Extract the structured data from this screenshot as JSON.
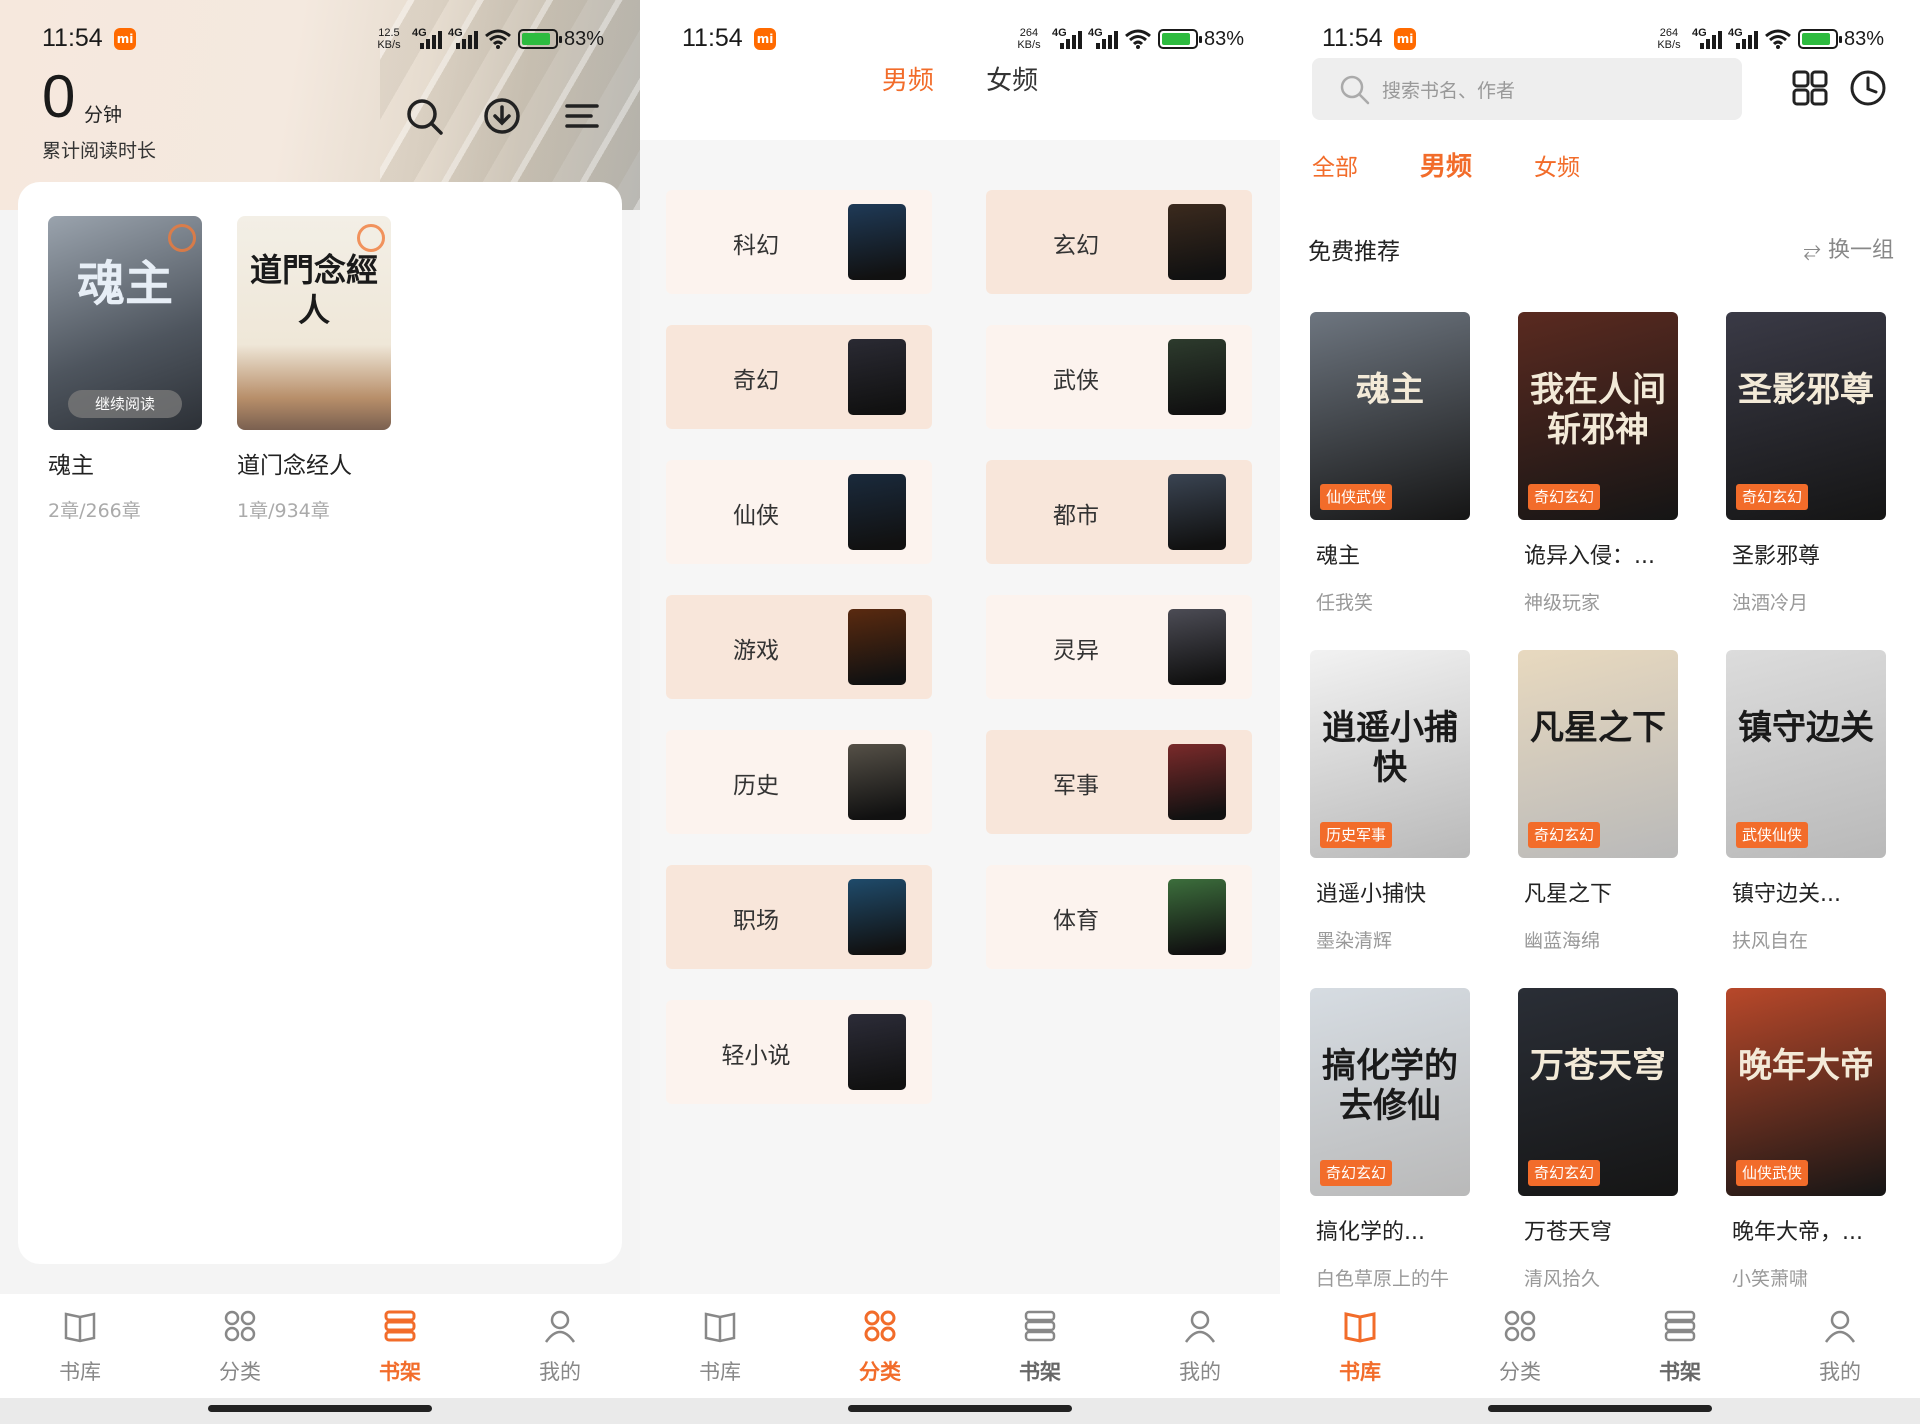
{
  "status": {
    "time": "11:54",
    "mi": "mi",
    "net1": "12.5",
    "net2": "264",
    "unit": "KB/s",
    "g": "4G",
    "battery": "83%"
  },
  "shelf": {
    "read_value": "0",
    "read_unit": "分钟",
    "read_label": "累计阅读时长",
    "continue_label": "继续阅读",
    "books": [
      {
        "title": "魂主",
        "progress": "2章/266章",
        "cover_text": "魂主"
      },
      {
        "title": "道门念经人",
        "progress": "1章/934章",
        "cover_text": "道門念經人"
      }
    ]
  },
  "category": {
    "tabs": [
      "男频",
      "女频"
    ],
    "items": [
      {
        "label": "科幻",
        "color": "#1f3a57"
      },
      {
        "label": "玄幻",
        "color": "#3b2a1e"
      },
      {
        "label": "奇幻",
        "color": "#2a2a33"
      },
      {
        "label": "武侠",
        "color": "#2d3b2d"
      },
      {
        "label": "仙侠",
        "color": "#1a2a3c"
      },
      {
        "label": "都市",
        "color": "#3a4452"
      },
      {
        "label": "游戏",
        "color": "#5a2a10"
      },
      {
        "label": "灵异",
        "color": "#4c4c55"
      },
      {
        "label": "历史",
        "color": "#555047"
      },
      {
        "label": "军事",
        "color": "#7a2a2a"
      },
      {
        "label": "职场",
        "color": "#1f4b6b"
      },
      {
        "label": "体育",
        "color": "#3c6e3c"
      },
      {
        "label": "轻小说",
        "color": "#2c2c38"
      }
    ]
  },
  "library": {
    "search_placeholder": "搜索书名、作者",
    "tabs": [
      "全部",
      "男频",
      "女频"
    ],
    "rec_title": "免费推荐",
    "rec_change": "换一组",
    "books": [
      {
        "title": "魂主",
        "author": "任我笑",
        "tag": "仙侠武侠",
        "cover_text": "魂主",
        "color": "#6e7680"
      },
      {
        "title": "诡异入侵：...",
        "author": "神级玩家",
        "tag": "奇幻玄幻",
        "cover_text": "我在人间斩邪神",
        "color": "#5a2a20"
      },
      {
        "title": "圣影邪尊",
        "author": "浊酒冷月",
        "tag": "奇幻玄幻",
        "cover_text": "圣影邪尊",
        "color": "#3a3a46"
      },
      {
        "title": "逍遥小捕快",
        "author": "墨染清辉",
        "tag": "历史军事",
        "cover_text": "逍遥小捕快",
        "color": "#f2f2f2"
      },
      {
        "title": "凡星之下",
        "author": "幽蓝海绵",
        "tag": "奇幻玄幻",
        "cover_text": "凡星之下",
        "color": "#e8d9bf"
      },
      {
        "title": "镇守边关...",
        "author": "扶风自在",
        "tag": "武侠仙侠",
        "cover_text": "镇守边关",
        "color": "#dcdcdc"
      },
      {
        "title": "搞化学的...",
        "author": "白色草原上的牛",
        "tag": "奇幻玄幻",
        "cover_text": "搞化学的去修仙",
        "color": "#d6dce2"
      },
      {
        "title": "万苍天穹",
        "author": "清风拾久",
        "tag": "奇幻玄幻",
        "cover_text": "万苍天穹",
        "color": "#2a2e36"
      },
      {
        "title": "晚年大帝，...",
        "author": "小笑萧啸",
        "tag": "仙侠武侠",
        "cover_text": "晚年大帝",
        "color": "#b8482a"
      }
    ]
  },
  "tabbar": {
    "items": [
      "书库",
      "分类",
      "书架",
      "我的"
    ]
  }
}
